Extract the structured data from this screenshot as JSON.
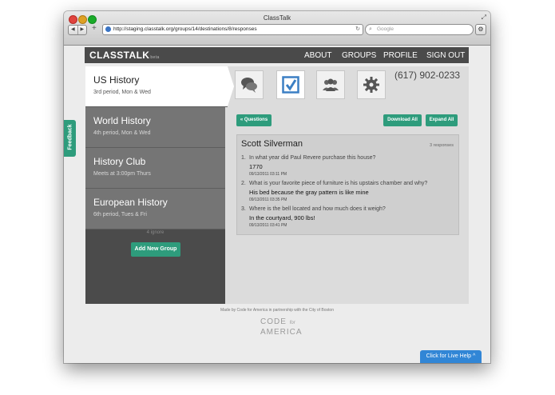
{
  "window": {
    "title": "ClassTalk"
  },
  "browser": {
    "url": "http://staging.classtalk.org/groups/14/destinations/8/responses",
    "search_placeholder": "Google"
  },
  "app": {
    "logo": "CLASSTALK",
    "logo_badge": "beta",
    "nav": [
      "ABOUT",
      "GROUPS",
      "PROFILE",
      "SIGN OUT"
    ]
  },
  "groups": [
    {
      "name": "US History",
      "desc": "3rd period, Mon & Wed",
      "active": true
    },
    {
      "name": "World History",
      "desc": "4th period, Mon & Wed"
    },
    {
      "name": "History Club",
      "desc": "Meets at 3:00pm Thurs"
    },
    {
      "name": "European History",
      "desc": "6th period, Tues & Fri"
    }
  ],
  "ignore_count": "4 ignore",
  "add_group_label": "Add New Group",
  "phone": "(617) 902-0233",
  "toolbar": {
    "questions": "« Questions",
    "download": "Download All",
    "expand": "Expand All"
  },
  "tools": [
    "chat-icon",
    "checkbox-icon",
    "people-icon",
    "gear-icon"
  ],
  "response": {
    "name": "Scott Silverman",
    "count": "3 responses",
    "items": [
      {
        "num": "1.",
        "q": "In what year did Paul Revere purchase this house?",
        "a": "1770",
        "ts": "09/13/2011 03:11 PM"
      },
      {
        "num": "2.",
        "q": "What is your favorite piece of furniture is his upstairs chamber and why?",
        "a": "His bed because the gray pattern is like mine",
        "ts": "09/13/2011 03:35 PM"
      },
      {
        "num": "3.",
        "q": "Where is the bell located and how much does it weigh?",
        "a": "In the courtyard, 900 lbs!",
        "ts": "09/13/2011 03:41 PM"
      }
    ]
  },
  "footer": "Made by Code for America in partnership with the City of Boston",
  "cfa": {
    "line1": "CODE",
    "for": "for",
    "line2": "AMERICA"
  },
  "livehelp": "Click for Live Help ^",
  "feedback": "Feedback",
  "colors": {
    "accent": "#2e9c7c",
    "livehelp": "#3186d6",
    "appbar": "#4a4a4a"
  }
}
